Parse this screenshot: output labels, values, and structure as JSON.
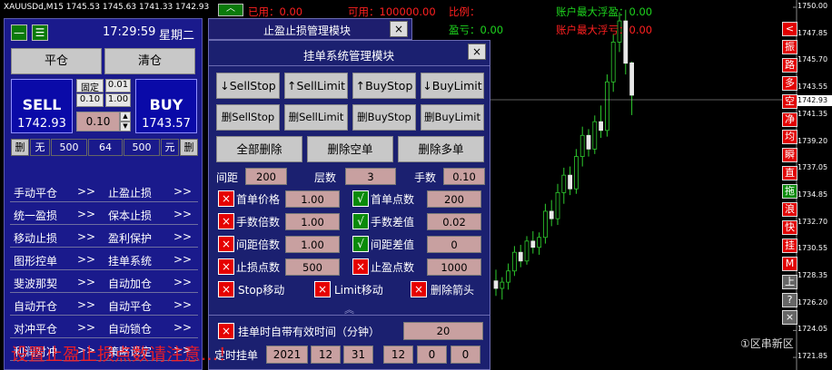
{
  "chart": {
    "title": "XAUUSDd,M15  1745.53 1745.63 1741.33 1742.93",
    "price_scale": [
      "1750.00",
      "1747.85",
      "1745.70",
      "1743.55",
      "1741.35",
      "1739.20",
      "1737.05",
      "1734.85",
      "1732.70",
      "1730.55",
      "1728.35",
      "1726.20",
      "1724.05",
      "1721.85"
    ],
    "current_price": "1742.93",
    "stats": {
      "used": "已用：0.00",
      "available": "可用：100000.00",
      "ratio": "比例：",
      "pnl": "盈亏：0.00",
      "max_float_profit": "账户最大浮盈：0.00",
      "max_float_loss": "账户最大浮亏：0.00"
    },
    "candles": [
      {
        "o": 1728.0,
        "h": 1728.9,
        "l": 1726.8,
        "c": 1727.4
      },
      {
        "o": 1727.4,
        "h": 1728.3,
        "l": 1726.5,
        "c": 1727.9
      },
      {
        "o": 1727.9,
        "h": 1729.4,
        "l": 1727.3,
        "c": 1728.8
      },
      {
        "o": 1728.8,
        "h": 1730.8,
        "l": 1728.4,
        "c": 1730.3
      },
      {
        "o": 1730.3,
        "h": 1730.9,
        "l": 1729.1,
        "c": 1729.6
      },
      {
        "o": 1729.6,
        "h": 1731.6,
        "l": 1729.3,
        "c": 1731.2
      },
      {
        "o": 1731.2,
        "h": 1732.0,
        "l": 1730.2,
        "c": 1730.7
      },
      {
        "o": 1730.7,
        "h": 1731.9,
        "l": 1730.1,
        "c": 1731.5
      },
      {
        "o": 1731.5,
        "h": 1734.2,
        "l": 1731.0,
        "c": 1733.6
      },
      {
        "o": 1733.6,
        "h": 1734.5,
        "l": 1732.4,
        "c": 1733.0
      },
      {
        "o": 1733.0,
        "h": 1735.8,
        "l": 1732.5,
        "c": 1735.1
      },
      {
        "o": 1735.1,
        "h": 1737.1,
        "l": 1734.2,
        "c": 1736.5
      },
      {
        "o": 1736.5,
        "h": 1737.2,
        "l": 1734.9,
        "c": 1735.4
      },
      {
        "o": 1735.4,
        "h": 1738.6,
        "l": 1735.0,
        "c": 1738.0
      },
      {
        "o": 1738.0,
        "h": 1740.4,
        "l": 1737.2,
        "c": 1739.7
      },
      {
        "o": 1739.7,
        "h": 1740.2,
        "l": 1738.0,
        "c": 1738.6
      },
      {
        "o": 1738.6,
        "h": 1741.3,
        "l": 1738.2,
        "c": 1740.8
      },
      {
        "o": 1740.8,
        "h": 1742.1,
        "l": 1739.5,
        "c": 1740.1
      },
      {
        "o": 1740.1,
        "h": 1744.6,
        "l": 1739.6,
        "c": 1744.0
      },
      {
        "o": 1744.0,
        "h": 1747.8,
        "l": 1743.2,
        "c": 1747.2
      },
      {
        "o": 1747.2,
        "h": 1749.6,
        "l": 1746.4,
        "c": 1748.9
      },
      {
        "o": 1748.9,
        "h": 1749.8,
        "l": 1744.6,
        "c": 1745.5
      },
      {
        "o": 1745.53,
        "h": 1745.63,
        "l": 1741.33,
        "c": 1742.93
      }
    ]
  },
  "left_panel": {
    "time": "17:29:59",
    "weekday": "星期二",
    "close_position": "平仓",
    "clear_position": "清仓",
    "sell_label": "SELL",
    "sell_price": "1742.93",
    "buy_label": "BUY",
    "buy_price": "1743.57",
    "fixed_label": "固定",
    "lot_options": [
      "0.01",
      "0.10",
      "1.00"
    ],
    "lot_value": "0.10",
    "row": [
      "删",
      "无",
      "500",
      "64",
      "500",
      "元",
      "删"
    ],
    "menu": [
      {
        "left": "手动平仓",
        "arrow1": ">>",
        "right": "止盈止损",
        "arrow2": ">>"
      },
      {
        "left": "统一盈损",
        "arrow1": ">>",
        "right": "保本止损",
        "arrow2": ">>"
      },
      {
        "left": "移动止损",
        "arrow1": ">>",
        "right": "盈利保护",
        "arrow2": ">>"
      },
      {
        "left": "图形控单",
        "arrow1": ">>",
        "right": "挂单系统",
        "arrow2": ">>"
      },
      {
        "left": "斐波那契",
        "arrow1": ">>",
        "right": "自动加仓",
        "arrow2": ">>"
      },
      {
        "left": "自动开仓",
        "arrow1": ">>",
        "right": "自动平仓",
        "arrow2": ">>"
      },
      {
        "left": "对冲平仓",
        "arrow1": ">>",
        "right": "自动锁仓",
        "arrow2": ">>"
      },
      {
        "left": "利润对冲",
        "arrow1": ">>",
        "right": "策略设定",
        "arrow2": ">>"
      }
    ]
  },
  "dialog_back": {
    "title": "止盈止损管理模块"
  },
  "dialog": {
    "title": "挂单系统管理模块",
    "buttons_row1": [
      "↓SellStop",
      "↑SellLimit",
      "↑BuyStop",
      "↓BuyLimit"
    ],
    "buttons_row2": [
      "删SellStop",
      "删SellLimit",
      "删BuyStop",
      "删BuyLimit"
    ],
    "buttons_row3": [
      "全部删除",
      "删除空单",
      "删除多单"
    ],
    "spacing_label": "间距",
    "spacing_value": "200",
    "levels_label": "层数",
    "levels_value": "3",
    "lots_label": "手数",
    "lots_value": "0.10",
    "params": [
      {
        "l_label": "首单价格",
        "l_value": "1.00",
        "r_label": "首单点数",
        "r_value": "200",
        "r_checked": true
      },
      {
        "l_label": "手数倍数",
        "l_value": "1.00",
        "r_label": "手数差值",
        "r_value": "0.02",
        "r_checked": true
      },
      {
        "l_label": "间距倍数",
        "l_value": "1.00",
        "r_label": "间距差值",
        "r_value": "0",
        "r_checked": true
      },
      {
        "l_label": "止损点数",
        "l_value": "500",
        "r_label": "止盈点数",
        "r_value": "1000",
        "r_checked": false
      }
    ],
    "options": [
      "Stop移动",
      "Limit移动",
      "删除箭头"
    ],
    "collapse_glyph": "︽",
    "expiry_label": "挂单时自带有效时间（分钟）",
    "expiry_value": "20",
    "timed_label": "定时挂单",
    "date_fields": [
      "2021",
      "12",
      "31",
      "12",
      "0",
      "0"
    ]
  },
  "right_toolbar": {
    "items": [
      {
        "t": "<",
        "c": "red"
      },
      {
        "t": "振",
        "c": "red"
      },
      {
        "t": "路",
        "c": "red"
      },
      {
        "t": "多",
        "c": "red"
      },
      {
        "t": "空",
        "c": "red"
      },
      {
        "t": "净",
        "c": "red"
      },
      {
        "t": "均",
        "c": "red"
      },
      {
        "t": "瞬",
        "c": "red"
      },
      {
        "t": "直",
        "c": "red"
      },
      {
        "t": "拖",
        "c": "grn"
      },
      {
        "t": "浪",
        "c": "red"
      },
      {
        "t": "快",
        "c": "red"
      },
      {
        "t": "挂",
        "c": "red"
      },
      {
        "t": "M",
        "c": "red"
      },
      {
        "t": "上",
        "c": "gry"
      },
      {
        "t": "?",
        "c": "gry"
      },
      {
        "t": "×",
        "c": "gry"
      }
    ]
  },
  "overlay_text": "设置止盈止损点数请注意…！",
  "watermark": "①区串新区"
}
